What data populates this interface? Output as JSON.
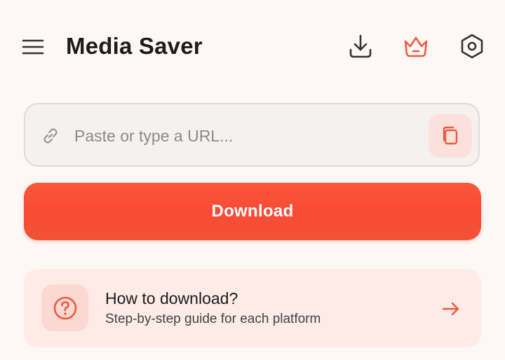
{
  "header": {
    "title": "Media Saver",
    "icons": {
      "menu": "menu-icon",
      "downloads": "download-icon",
      "premium": "crown-icon",
      "settings": "settings-icon"
    }
  },
  "url_input": {
    "placeholder": "Paste or type a URL...",
    "value": "",
    "leading_icon": "link-icon",
    "paste_icon": "paste-icon"
  },
  "primary_action": {
    "label": "Download"
  },
  "howto": {
    "title": "How to download?",
    "subtitle": "Step-by-step guide for each platform",
    "icon": "help-icon",
    "trailing_icon": "arrow-right-icon"
  },
  "colors": {
    "accent": "#fa4a36",
    "background": "#fdf8f6",
    "card_bg": "#fdebe7",
    "icon_dark": "#333333",
    "icon_accent": "#ee5a3f"
  }
}
